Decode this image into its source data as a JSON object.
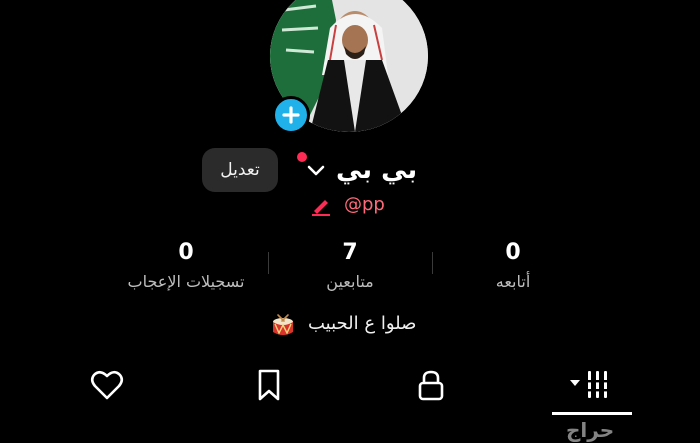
{
  "profile": {
    "display_name": "بي بي",
    "handle": "@pp",
    "edit_label": "تعديل",
    "bio": "صلوا ع الحبيب"
  },
  "stats": {
    "following": {
      "value": "0",
      "label": "أتابعه"
    },
    "followers": {
      "value": "7",
      "label": "متابعين"
    },
    "likes": {
      "value": "0",
      "label": "تسجيلات الإعجاب"
    }
  },
  "tabs": [
    {
      "icon": "grid-icon",
      "selected": true
    },
    {
      "icon": "lock-icon",
      "selected": false
    },
    {
      "icon": "bookmark-icon",
      "selected": false
    },
    {
      "icon": "heart-icon",
      "selected": false
    }
  ],
  "watermark": "حراج",
  "colors": {
    "background": "#000000",
    "accent_blue": "#20b1ea",
    "accent_red": "#fe2c55",
    "handle_color": "#ff6b7a"
  }
}
